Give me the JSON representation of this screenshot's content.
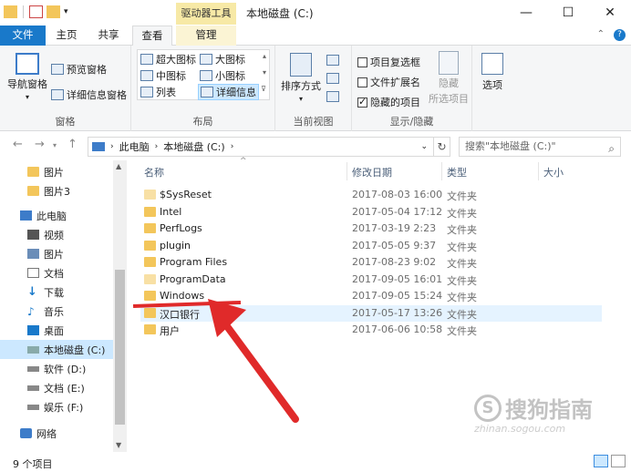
{
  "window": {
    "title": "本地磁盘 (C:)",
    "context_tab_title": "驱动器工具",
    "minimize": "—",
    "maximize": "☐",
    "close": "✕"
  },
  "tabs": {
    "file": "文件",
    "home": "主页",
    "share": "共享",
    "view": "查看",
    "manage": "管理",
    "collapse": "⌃",
    "help": "?"
  },
  "ribbon": {
    "pane": {
      "label": "窗格",
      "nav_pane": "导航窗格",
      "preview_pane": "预览窗格",
      "details_pane": "详细信息窗格"
    },
    "layout": {
      "label": "布局",
      "extra_large": "超大图标",
      "large": "大图标",
      "medium": "中图标",
      "small": "小图标",
      "list": "列表",
      "details": "详细信息"
    },
    "current_view": {
      "label": "当前视图",
      "sort_by": "排序方式"
    },
    "show_hide": {
      "label": "显示/隐藏",
      "item_checkboxes": "项目复选框",
      "item_checkboxes_checked": false,
      "file_extensions": "文件扩展名",
      "file_extensions_checked": false,
      "hidden_items": "隐藏的项目",
      "hidden_items_checked": true,
      "hide": "隐藏",
      "hide_selected": "所选项目"
    },
    "options": "选项"
  },
  "address": {
    "path": [
      "此电脑",
      "本地磁盘 (C:)"
    ],
    "search_placeholder": "搜索\"本地磁盘 (C:)\""
  },
  "nav": {
    "items": [
      {
        "label": "图片",
        "icon": "folder-icon"
      },
      {
        "label": "图片3",
        "icon": "folder-icon"
      },
      {
        "label": "此电脑",
        "icon": "computer-icon"
      },
      {
        "label": "视频",
        "icon": "video-icon"
      },
      {
        "label": "图片",
        "icon": "pictures-icon"
      },
      {
        "label": "文档",
        "icon": "documents-icon"
      },
      {
        "label": "下载",
        "icon": "download-icon"
      },
      {
        "label": "音乐",
        "icon": "music-icon"
      },
      {
        "label": "桌面",
        "icon": "desktop-icon"
      },
      {
        "label": "本地磁盘 (C:)",
        "icon": "drive-icon"
      },
      {
        "label": "软件 (D:)",
        "icon": "drive-icon"
      },
      {
        "label": "文档 (E:)",
        "icon": "drive-icon"
      },
      {
        "label": "娱乐 (F:)",
        "icon": "drive-icon"
      },
      {
        "label": "网络",
        "icon": "network-icon"
      }
    ]
  },
  "list": {
    "columns": {
      "name": "名称",
      "modified": "修改日期",
      "type": "类型",
      "size": "大小"
    },
    "rows": [
      {
        "name": "$SysReset",
        "modified": "2017-08-03 16:00",
        "type": "文件夹",
        "hidden": true
      },
      {
        "name": "Intel",
        "modified": "2017-05-04 17:12",
        "type": "文件夹",
        "hidden": false
      },
      {
        "name": "PerfLogs",
        "modified": "2017-03-19 2:23",
        "type": "文件夹",
        "hidden": false
      },
      {
        "name": "plugin",
        "modified": "2017-05-05 9:37",
        "type": "文件夹",
        "hidden": false
      },
      {
        "name": "Program Files",
        "modified": "2017-08-23 9:02",
        "type": "文件夹",
        "hidden": false
      },
      {
        "name": "ProgramData",
        "modified": "2017-09-05 16:01",
        "type": "文件夹",
        "hidden": true
      },
      {
        "name": "Windows",
        "modified": "2017-09-05 15:24",
        "type": "文件夹",
        "hidden": false
      },
      {
        "name": "汉口银行",
        "modified": "2017-05-17 13:26",
        "type": "文件夹",
        "hidden": false
      },
      {
        "name": "用户",
        "modified": "2017-06-06 10:58",
        "type": "文件夹",
        "hidden": false
      }
    ]
  },
  "status": {
    "count": "9 个项目"
  },
  "watermark": {
    "text": "搜狗指南",
    "url": "zhinan.sogou.com",
    "logo": "S"
  },
  "colors": {
    "accent": "#1979ca",
    "selection": "#cce8ff",
    "hover": "#e5f3ff",
    "folder": "#f3c65b",
    "annotation": "#e02a2a"
  }
}
